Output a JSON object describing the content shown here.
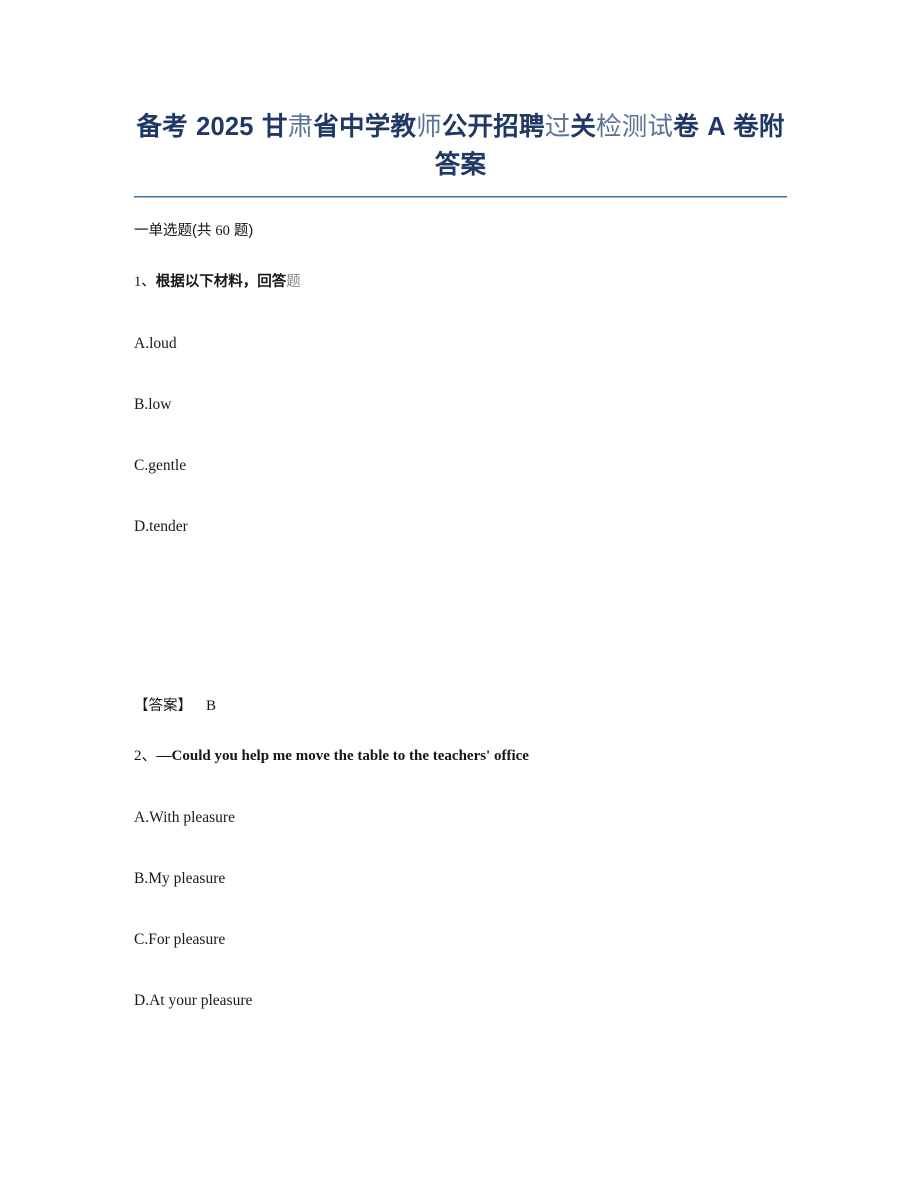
{
  "document": {
    "title_line_1": "备考 2025 甘肃省中学教师公开招聘过关检测试卷 A 卷附答案",
    "title_part_a": "备考 2025 甘",
    "title_part_b": "肃",
    "title_part_c": "省中学教",
    "title_part_d": "师",
    "title_part_e": "公开招聘",
    "title_part_f": "过",
    "title_part_g": "关",
    "title_part_h": "检测试",
    "title_part_i": "卷 A 卷附答案",
    "title_color": "#1F3864",
    "title_soft_color": "#5b7396",
    "divider_color": "#3d6ea8",
    "background_color": "#ffffff",
    "text_color": "#161616"
  },
  "section": {
    "heading": "一单选题(共 60 题)",
    "heading_prefix": "一单选题(共 ",
    "heading_count": "60",
    "heading_suffix": " 题)"
  },
  "questions": [
    {
      "number": "1、",
      "stem_main": "根据以下材料，回答",
      "stem_soft": "题",
      "stem_full": "1、根据以下材料，回答题",
      "has_material_placeholder": true,
      "options": [
        {
          "label": "A.loud"
        },
        {
          "label": "B.low"
        },
        {
          "label": "C.gentle"
        },
        {
          "label": "D.tender"
        }
      ],
      "answer_label": "【答案】",
      "answer_value": "B"
    },
    {
      "number": "2、",
      "stem_main": "—Could you help me move the table to the teachers' office",
      "stem_full": "2、—Could you help me move the table to the teachers' office",
      "has_material_placeholder": false,
      "options": [
        {
          "label": "A.With pleasure"
        },
        {
          "label": "B.My pleasure"
        },
        {
          "label": "C.For pleasure"
        },
        {
          "label": "D.At your pleasure"
        }
      ]
    }
  ]
}
